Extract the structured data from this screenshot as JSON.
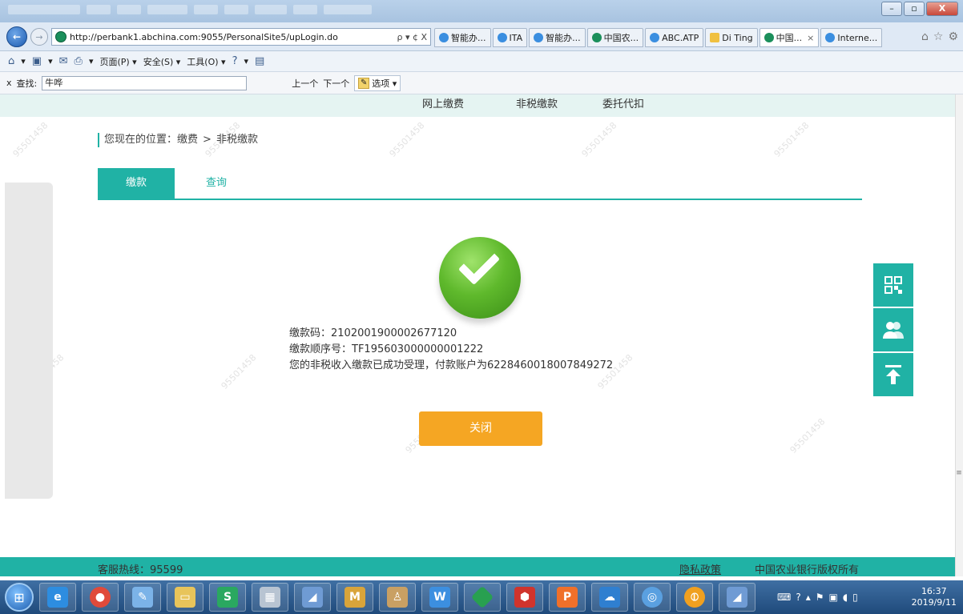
{
  "browser": {
    "url": "http://perbank1.abchina.com:9055/PersonalSite5/upLogin.do",
    "address_tools": "ρ ▾ ¢ X",
    "tabs": [
      {
        "label": "智能办...",
        "icon": "ie-icon",
        "active": false
      },
      {
        "label": "ITA",
        "icon": "ie-icon",
        "active": false
      },
      {
        "label": "智能办...",
        "icon": "ie-icon",
        "active": false
      },
      {
        "label": "中国农...",
        "icon": "abc-icon",
        "active": false
      },
      {
        "label": "ABC.ATP",
        "icon": "ie-icon",
        "active": false
      },
      {
        "label": "Di Ting",
        "icon": "app-icon",
        "active": false
      },
      {
        "label": "中国...",
        "icon": "abc-icon",
        "active": true
      },
      {
        "label": "Interne...",
        "icon": "ie-icon",
        "active": false
      }
    ],
    "tab_close": "×",
    "nav_right": [
      "⌂",
      "☆",
      "⚙"
    ],
    "window_controls": {
      "minimize": "–",
      "maximize": "▫",
      "close": "X"
    }
  },
  "command_bar": {
    "items": [
      "▾",
      "▾",
      "▾",
      "页面(P) ▾",
      "安全(S) ▾",
      "工具(O) ▾",
      "▾"
    ]
  },
  "find_bar": {
    "close": "x",
    "label": "查找:",
    "value": "牛哗",
    "prev": "上一个",
    "next": "下一个",
    "options": "选项 ▾",
    "pencil": "✎"
  },
  "page": {
    "top_nav": [
      "网上缴费",
      "非税缴款",
      "委托代扣"
    ],
    "breadcrumb": {
      "prefix": "您现在的位置：",
      "level1": "缴费",
      "separator": ">",
      "level2": "非税缴款"
    },
    "tabs": {
      "active": "缴款",
      "inactive": "查询"
    },
    "result": {
      "line1": "缴款码：2102001900002677120",
      "line2": "缴款顺序号：TF195603000000001222",
      "line3": "您的非税收入缴款已成功受理，付款账户为6228460018007849272"
    },
    "close_button": "关闭",
    "footer": {
      "hotline": "客服热线：95599",
      "privacy": "隐私政策",
      "copyright": "中国农业银行版权所有"
    },
    "float_icons": [
      "qr-code-icon",
      "customer-service-icon",
      "back-to-top-icon"
    ],
    "colors": {
      "accent": "#20b2a5",
      "button": "#f5a623",
      "success": "#5fb92c"
    }
  },
  "taskbar": {
    "time": "16:37",
    "date": "2019/9/11"
  }
}
